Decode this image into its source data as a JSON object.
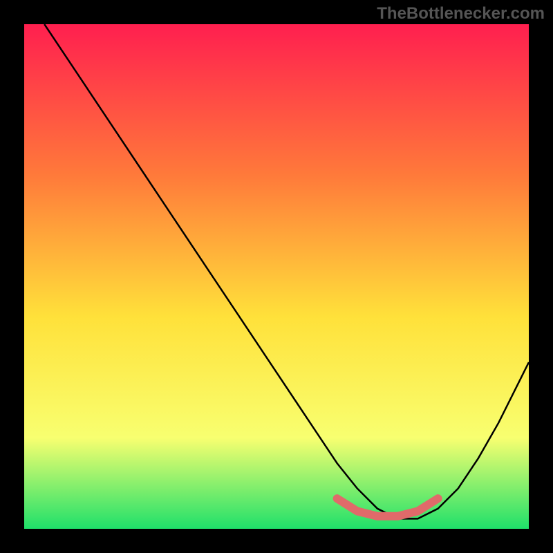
{
  "watermark": "TheBottlenecker.com",
  "chart_data": {
    "type": "line",
    "title": "",
    "xlabel": "",
    "ylabel": "",
    "categories": [],
    "xlim": [
      0,
      100
    ],
    "ylim": [
      0,
      100
    ],
    "gradient": {
      "top": "#ff1f4f",
      "mid_upper": "#ff7a3a",
      "mid": "#ffe13a",
      "mid_lower": "#f8ff70",
      "bottom": "#1fe06a"
    },
    "series": [
      {
        "name": "bottleneck-curve",
        "color": "#000000",
        "x": [
          4,
          8,
          12,
          18,
          24,
          30,
          36,
          42,
          48,
          54,
          58,
          62,
          66,
          70,
          74,
          78,
          82,
          86,
          90,
          94,
          98,
          100
        ],
        "values": [
          100,
          94,
          88,
          79,
          70,
          61,
          52,
          43,
          34,
          25,
          19,
          13,
          8,
          4,
          2,
          2,
          4,
          8,
          14,
          21,
          29,
          33
        ]
      }
    ],
    "highlight": {
      "color": "#e06a6a",
      "x": [
        62,
        66,
        70,
        74,
        78,
        82
      ],
      "values": [
        6,
        3.5,
        2.5,
        2.5,
        3.5,
        6
      ]
    }
  }
}
